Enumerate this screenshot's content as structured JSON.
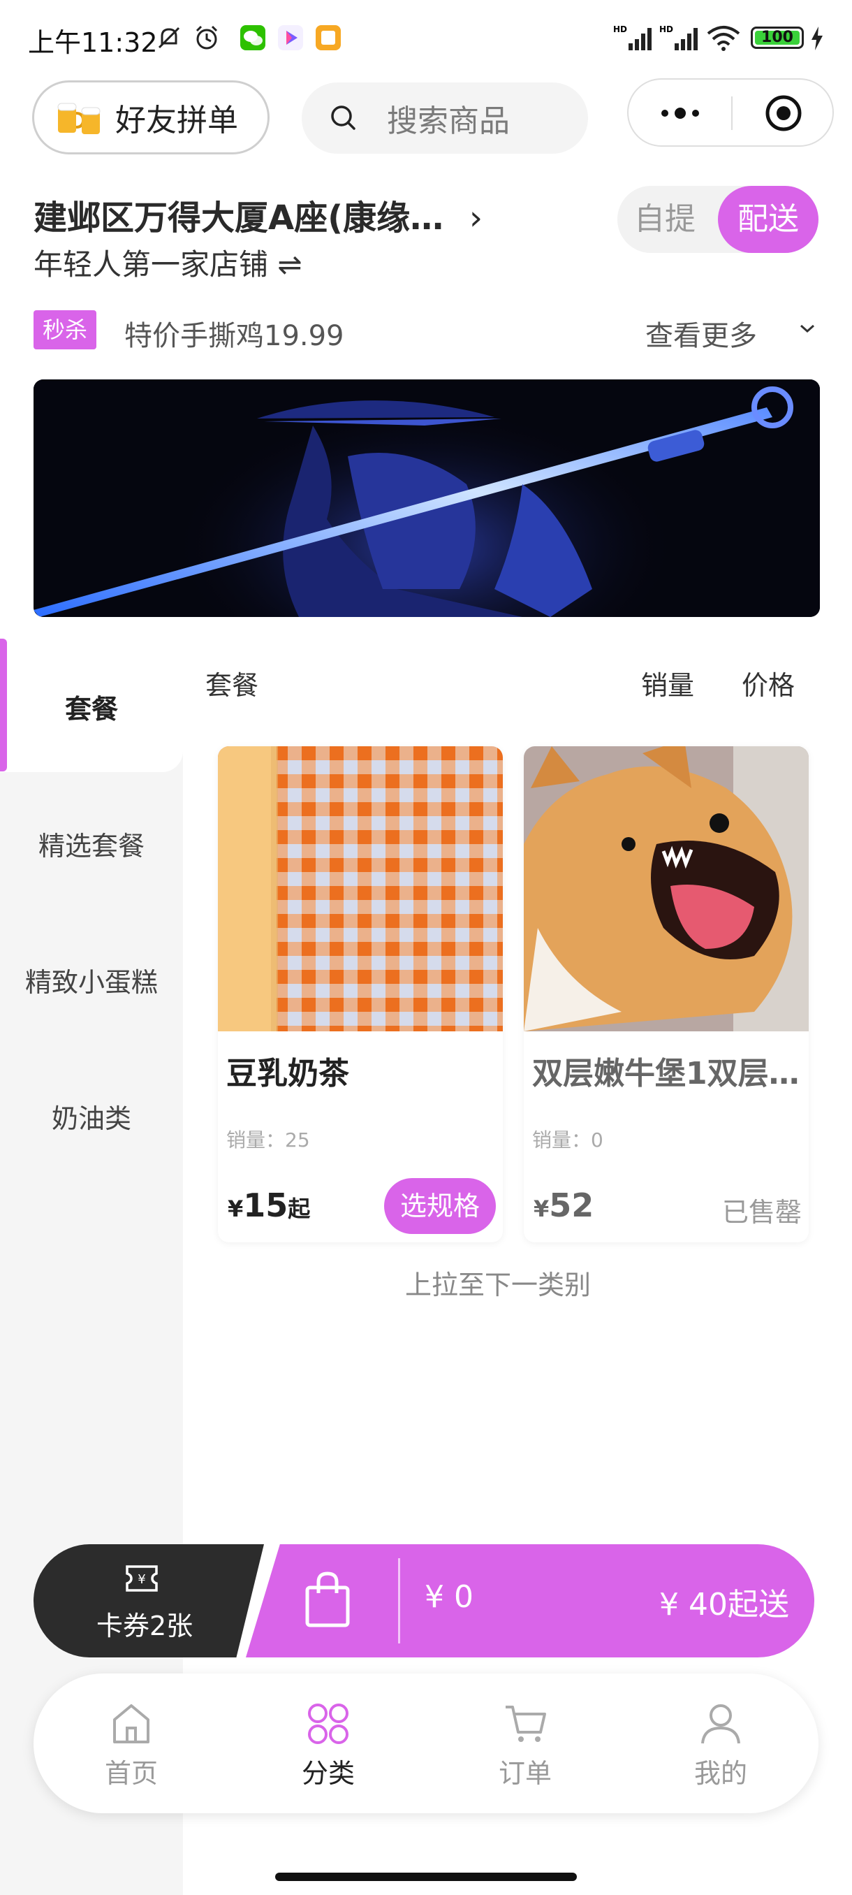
{
  "status_bar": {
    "time": "上午11:32",
    "battery": "100",
    "battery_level_percent": 100
  },
  "header": {
    "friends_label": "好友拼单",
    "search_placeholder": "搜索商品",
    "friends_icon": "beer-icon",
    "search_icon": "search-icon"
  },
  "store": {
    "address": "建邺区万得大厦A座(康缘…",
    "address_chevron": "›",
    "name": "年轻人第一家店铺 ⇌",
    "mode_pickup": "自提",
    "mode_delivery": "配送"
  },
  "flash_sale": {
    "badge": "秒杀",
    "text": "特价手撕鸡19.99",
    "more": "查看更多"
  },
  "sidebar": {
    "items": [
      {
        "label": "套餐"
      },
      {
        "label": "精选套餐"
      },
      {
        "label": "精致小蛋糕"
      },
      {
        "label": "奶油类"
      }
    ]
  },
  "content": {
    "category_title": "套餐",
    "sort_sales": "销量",
    "sort_price": "价格",
    "pull_hint": "上拉至下一类别"
  },
  "products": [
    {
      "name": "豆乳奶茶",
      "sales": "销量：25",
      "currency": "¥",
      "price": "15",
      "price_suffix": "起",
      "action": "选规格"
    },
    {
      "name": "双层嫩牛堡1双层…",
      "sales": "销量：0",
      "currency": "¥",
      "price": "52",
      "status": "已售罄"
    }
  ],
  "cart": {
    "coupon_label": "卡券2张",
    "total": "¥ 0",
    "minimum": "¥ 40起送"
  },
  "tabs": [
    {
      "label": "首页",
      "icon": "home-icon"
    },
    {
      "label": "分类",
      "icon": "category-icon"
    },
    {
      "label": "订单",
      "icon": "cart-icon"
    },
    {
      "label": "我的",
      "icon": "user-icon"
    }
  ],
  "colors": {
    "accent": "#d964e9",
    "dark": "#2c2c2c"
  }
}
